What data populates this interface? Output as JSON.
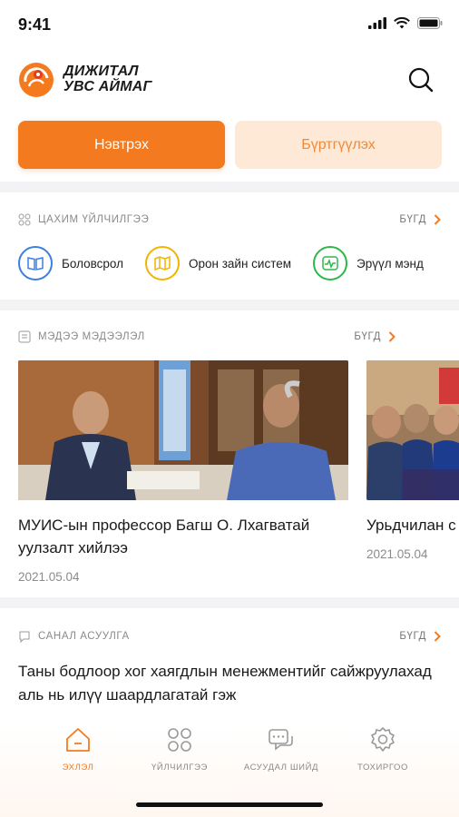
{
  "status": {
    "time": "9:41"
  },
  "header": {
    "logo_line1": "ДИЖИТАЛ",
    "logo_line2": "УВС АЙМАГ",
    "search_icon": "search-icon"
  },
  "auth": {
    "login_label": "Нэвтрэх",
    "register_label": "Бүртгүүлэх"
  },
  "services_section": {
    "title": "ЦАХИМ ҮЙЛЧИЛГЭЭ",
    "see_all": "БҮГД",
    "items": [
      {
        "label": "Боловсрол",
        "icon": "book-icon",
        "color": "#3d7fe0"
      },
      {
        "label": "Орон зайн систем",
        "icon": "map-icon",
        "color": "#f2b400"
      },
      {
        "label": "Эрүүл мэнд",
        "icon": "health-icon",
        "color": "#2fb84a"
      }
    ]
  },
  "news_section": {
    "title": "МЭДЭЭ МЭДЭЭЛЭЛ",
    "see_all": "БҮГД",
    "items": [
      {
        "title": "МУИС-ын профессор Багш О. Лхагватай уулзалт хийлээ",
        "date": "2021.05.04"
      },
      {
        "title": "Урьдчилан с шинжилгээ, с",
        "date": "2021.05.04"
      }
    ]
  },
  "poll_section": {
    "title": "САНАЛ АСУУЛГА",
    "see_all": "БҮГД",
    "question": "Таны бодлоор хог хаягдлын менежментийг сайжруулахад аль нь илүү шаардлагатай гэж"
  },
  "tabbar": {
    "items": [
      {
        "label": "ЭХЛЭЛ",
        "icon": "home-icon",
        "active": true
      },
      {
        "label": "ҮЙЛЧИЛГЭЭ",
        "icon": "services-grid-icon",
        "active": false
      },
      {
        "label": "АСУУДАЛ ШИЙД",
        "icon": "chat-icon",
        "active": false
      },
      {
        "label": "ТОХИРГОО",
        "icon": "settings-icon",
        "active": false
      }
    ]
  },
  "colors": {
    "accent": "#f47a20",
    "accent_light": "#fde9d6"
  }
}
